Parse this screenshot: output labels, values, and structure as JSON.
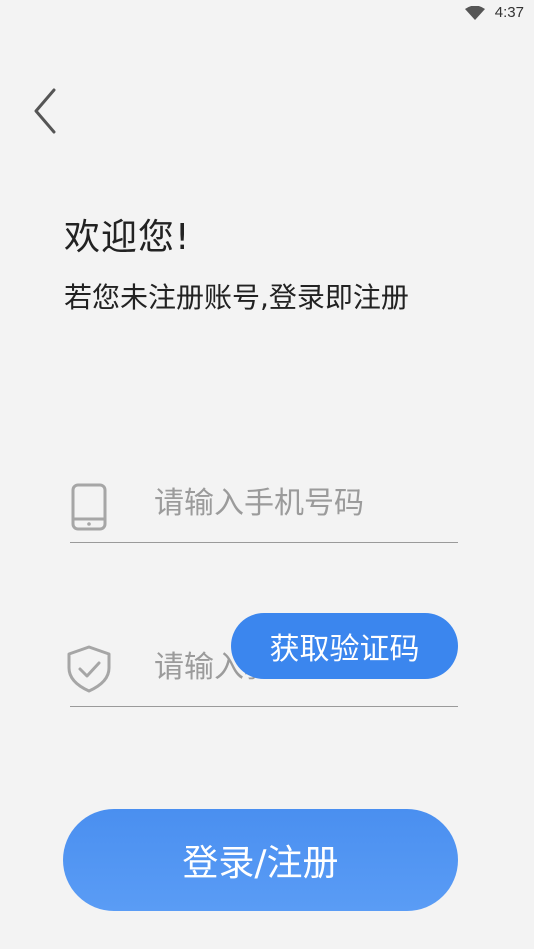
{
  "status_bar": {
    "time": "4:37",
    "wifi_icon": "wifi-icon"
  },
  "nav": {
    "back_icon": "chevron-left-icon"
  },
  "welcome": {
    "title": "欢迎您!",
    "subtitle": "若您未注册账号,登录即注册"
  },
  "form": {
    "phone": {
      "icon": "phone-icon",
      "placeholder": "请输入手机号码",
      "value": ""
    },
    "code": {
      "icon": "shield-check-icon",
      "placeholder": "请输入验证码",
      "value": ""
    },
    "get_code_label": "获取验证码",
    "submit_label": "登录/注册"
  },
  "colors": {
    "background": "#f3f3f3",
    "accent": "#3b86ee",
    "divider": "#9a9a9a",
    "placeholder": "#9b9b9b"
  }
}
